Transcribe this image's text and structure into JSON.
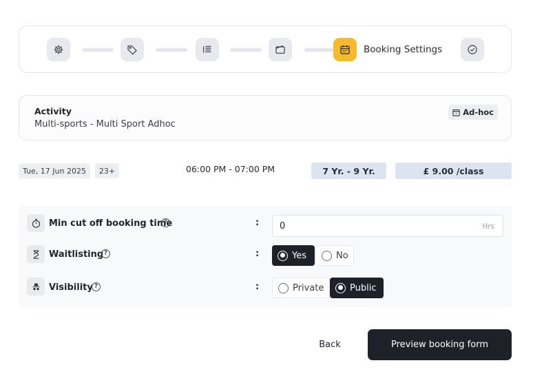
{
  "stepper": {
    "steps": [
      {
        "icon": "gear-icon",
        "state": "done"
      },
      {
        "icon": "tag-icon",
        "state": "done"
      },
      {
        "icon": "list-icon",
        "state": "done"
      },
      {
        "icon": "wallet-icon",
        "state": "done"
      },
      {
        "icon": "calendar-icon",
        "state": "active",
        "label": "Booking Settings"
      },
      {
        "icon": "check-circle-icon",
        "state": "pending"
      }
    ],
    "active_color": "#f6bb2c"
  },
  "activity": {
    "title": "Activity",
    "name": "Multi-sports - Multi Sport Adhoc",
    "badge": "Ad-hoc"
  },
  "session": {
    "date": "Tue, 17 Jun 2025",
    "spots": "23+",
    "time": "06:00 PM - 07:00 PM",
    "age_range": "7 Yr. - 9 Yr.",
    "price": "£ 9.00 /class"
  },
  "settings": {
    "cutoff": {
      "label": "Min cut off booking time",
      "value": "0",
      "unit": "Hrs",
      "icon": "stopwatch-icon"
    },
    "waitlisting": {
      "label": "Waitlisting",
      "options": [
        "Yes",
        "No"
      ],
      "selected": "Yes",
      "icon": "hourglass-icon"
    },
    "visibility": {
      "label": "Visibility",
      "options": [
        "Private",
        "Public"
      ],
      "selected": "Public",
      "icon": "incognito-icon"
    },
    "colon": ":",
    "help_glyph": "?"
  },
  "footer": {
    "back_label": "Back",
    "preview_label": "Preview booking form"
  }
}
